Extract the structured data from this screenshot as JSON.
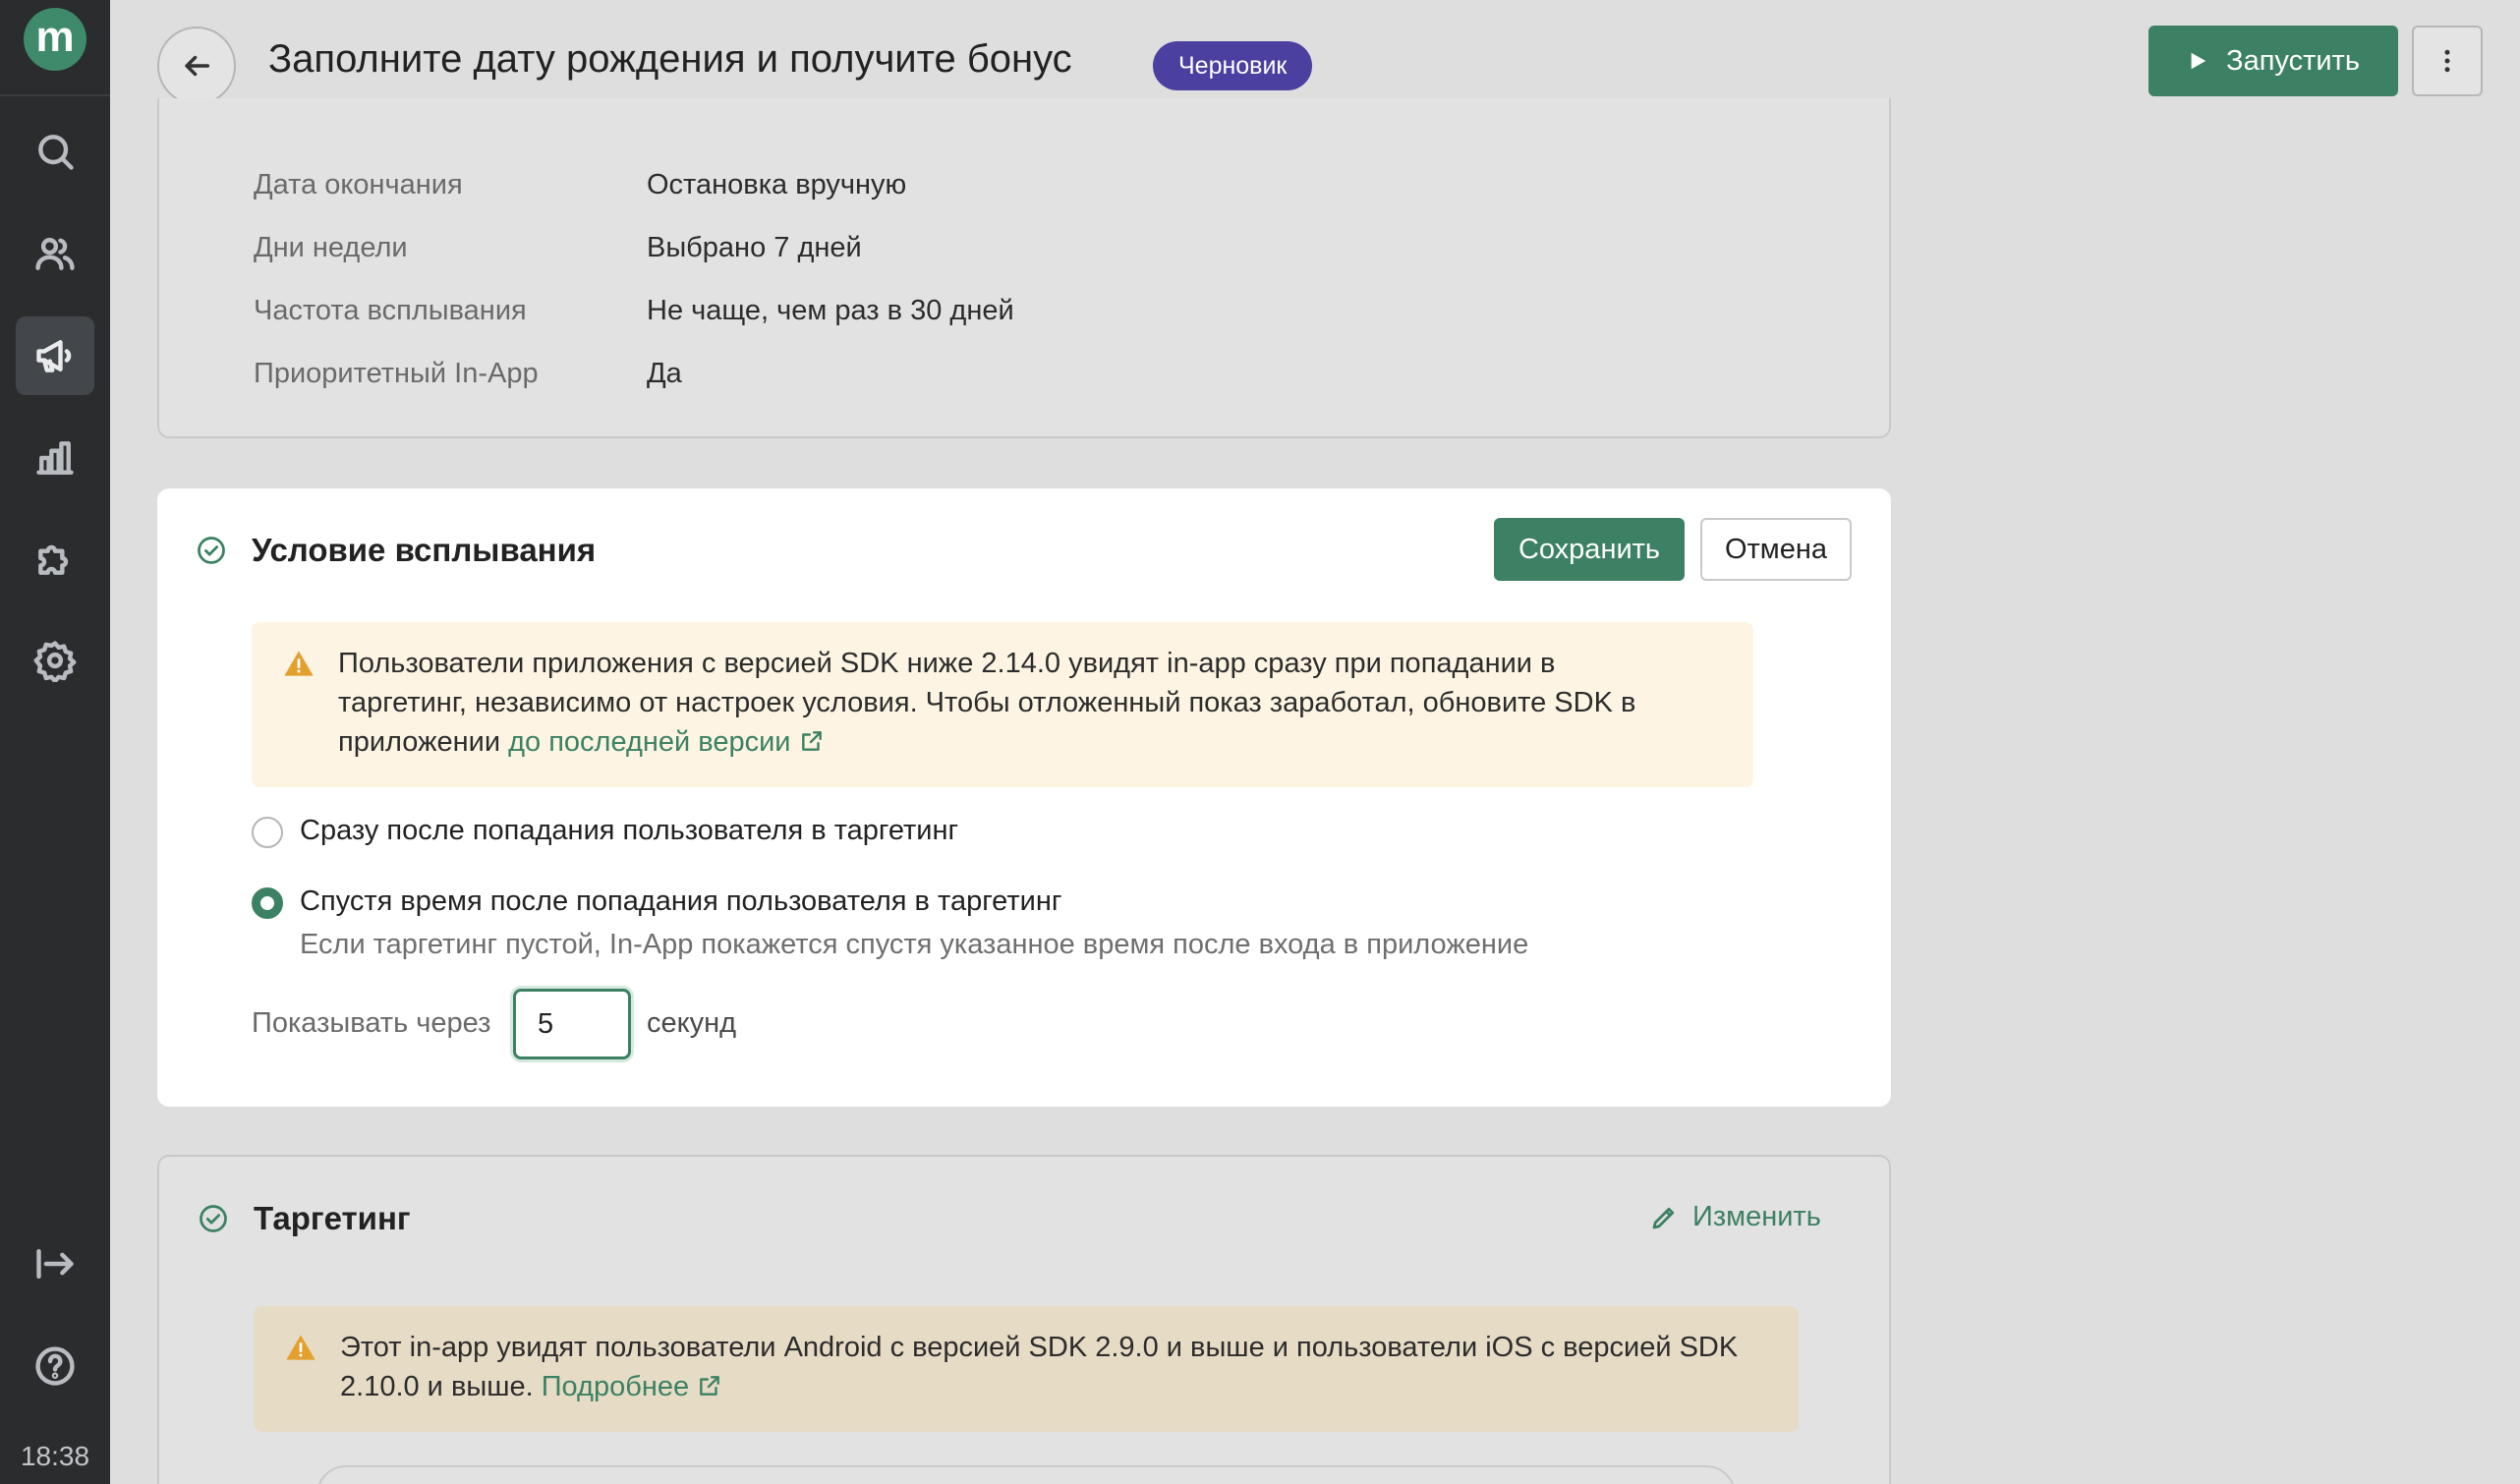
{
  "app": {
    "logo_letter": "m",
    "time": "18:38"
  },
  "sidebar": {
    "items": [
      {
        "icon": "search-icon",
        "active": false
      },
      {
        "icon": "users-icon",
        "active": false
      },
      {
        "icon": "megaphone-icon",
        "active": true
      },
      {
        "icon": "analytics-icon",
        "active": false
      },
      {
        "icon": "puzzle-icon",
        "active": false
      },
      {
        "icon": "gear-icon",
        "active": false
      }
    ],
    "bottom_items": [
      {
        "icon": "logout-icon"
      },
      {
        "icon": "help-icon"
      }
    ]
  },
  "header": {
    "title": "Заполните дату рождения и получите бонус",
    "status": "Черновик",
    "run_label": "Запустить"
  },
  "settings_card": {
    "rows": [
      {
        "label": "Дата окончания",
        "value": "Остановка вручную"
      },
      {
        "label": "Дни недели",
        "value": "Выбрано 7 дней"
      },
      {
        "label": "Частота всплывания",
        "value": "Не чаще, чем раз в 30 дней"
      },
      {
        "label": "Приоритетный In-App",
        "value": "Да"
      }
    ]
  },
  "condition_card": {
    "title": "Условие всплывания",
    "save_label": "Сохранить",
    "cancel_label": "Отмена",
    "warning": {
      "line1": "Пользователи приложения с версией SDK ниже 2.14.0 увидят in-app сразу при попадании в",
      "line2": "таргетинг, независимо от настроек условия. Чтобы отложенный показ заработал, обновите SDK в",
      "line3": "приложении ",
      "link": "до последней версии"
    },
    "options": [
      {
        "label": "Сразу после попадания пользователя в таргетинг",
        "checked": false
      },
      {
        "label": "Спустя время после попадания пользователя в таргетинг",
        "checked": true,
        "hint": "Если таргетинг пустой, In-App покажется спустя указанное время после входа в приложение"
      }
    ],
    "delay": {
      "label": "Показывать через",
      "value": "5",
      "unit": "секунд"
    }
  },
  "targeting_card": {
    "title": "Таргетинг",
    "edit_label": "Изменить",
    "warning": {
      "line1": "Этот in-app увидят пользователи Android с версией SDK 2.9.0 и выше и пользователи iOS с версией SDK",
      "line2": "2.10.0 и выше. ",
      "link": "Подробнее"
    }
  },
  "colors": {
    "accent": "#3c8163",
    "badge": "#4b3fa0",
    "sidebar": "#2a2c2e",
    "warning_bg": "#fdf4e3",
    "warning_icon": "#e3a02f"
  }
}
